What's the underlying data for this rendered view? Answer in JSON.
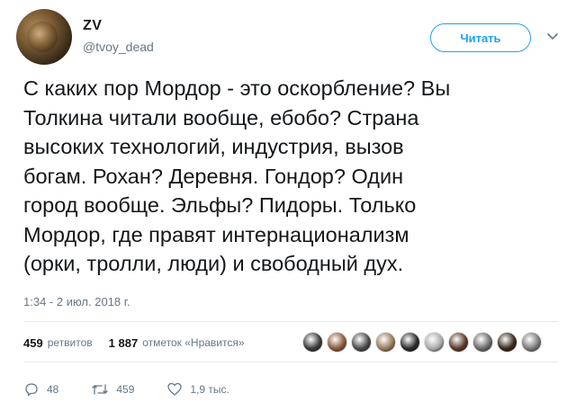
{
  "user": {
    "display_name": "ZV",
    "handle": "@tvoy_dead",
    "follow_label": "Читать"
  },
  "tweet": {
    "text": "С каких пор Мордор - это оскорбление? Вы\nТолкина читали вообще, ебобо? Страна\nвысоких технологий, индустрия, вызов\nбогам. Рохан? Деревня. Гондор? Один\nгород вообще. Эльфы? Пидоры. Только\nМордор, где правят интернационализм\n(орки, тролли, люди) и свободный дух.",
    "timestamp": "1:34 - 2 июл. 2018 г."
  },
  "stats": {
    "retweets_count": "459",
    "retweets_label": "ретвитов",
    "likes_count": "1 887",
    "likes_label": "отметок «Нравится»"
  },
  "liker_avatars": [
    "#3a3a3a",
    "#8a5a3a",
    "#4a4a4a",
    "#9a7a5a",
    "#2a2a2a",
    "#aaaaaa",
    "#5a3a2a",
    "#6a6a6a",
    "#3a2a1a",
    "#7a7a7a"
  ],
  "actions": {
    "reply_count": "48",
    "retweet_count": "459",
    "like_count": "1,9 тыс."
  },
  "colors": {
    "accent": "#1da1f2",
    "text": "#14171a",
    "secondary": "#657786"
  }
}
